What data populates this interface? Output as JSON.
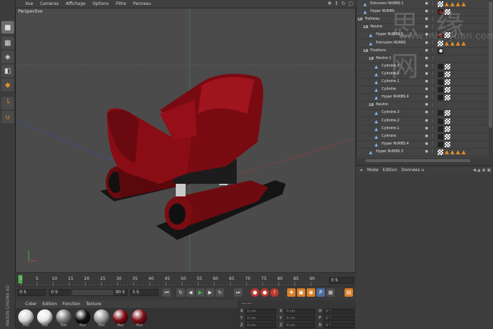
{
  "viewport_menu": [
    "Vue",
    "Caméras",
    "Affichage",
    "Options",
    "Filtre",
    "Panneau"
  ],
  "viewport_label": "Perspective",
  "timeline": {
    "ticks": [
      "0",
      "5",
      "10",
      "15",
      "20",
      "25",
      "30",
      "35",
      "40",
      "45",
      "50",
      "55",
      "60",
      "65",
      "70",
      "75",
      "80",
      "85",
      "90"
    ],
    "end_label": "0 S",
    "start_field": "0 S",
    "current_field": "0 S",
    "end_field": "90 S",
    "max_field": "3 S"
  },
  "material_menu": [
    "Créer",
    "Edition",
    "Fonction",
    "Texture"
  ],
  "materials": [
    {
      "label": "Mat",
      "color": "#d8d8d8"
    },
    {
      "label": "Mat",
      "color": "#e8e8e8"
    },
    {
      "label": "Mat",
      "color": "#7a7a7a"
    },
    {
      "label": "Mat",
      "color": "#111111"
    },
    {
      "label": "Mat",
      "color": "#9a9a9a"
    },
    {
      "label": "Mat",
      "color": "#7c0c12"
    },
    {
      "label": "Mat",
      "color": "#7e1016"
    }
  ],
  "coords": {
    "rows": [
      {
        "a": "X",
        "av": "0 cm",
        "b": "X",
        "bv": "0 cm",
        "c": "H",
        "cv": "0 °"
      },
      {
        "a": "Y",
        "av": "0 cm",
        "b": "Y",
        "bv": "0 cm",
        "c": "P",
        "cv": "0 °"
      },
      {
        "a": "Z",
        "av": "0 cm",
        "b": "Z",
        "bv": "0 cm",
        "c": "B",
        "cv": "0 °"
      }
    ]
  },
  "brand": "MAXON CINEMA 4D",
  "objects": [
    {
      "name": "Extrusion NURBS.1",
      "indent": 10,
      "icon": "nurbs",
      "tags": [
        "check",
        "tri",
        "tri",
        "tri",
        "tri"
      ]
    },
    {
      "name": "Hyper NURBS",
      "indent": 10,
      "icon": "nurbs",
      "tags": [
        "dot",
        "check"
      ]
    },
    {
      "name": "Traîneau",
      "indent": 2,
      "icon": "null",
      "tags": []
    },
    {
      "name": "Neutre",
      "indent": 10,
      "icon": "null",
      "tags": []
    },
    {
      "name": "Hyper NURBS.5",
      "indent": 18,
      "icon": "nurbs",
      "tags": [
        "dot",
        "check"
      ]
    },
    {
      "name": "Extrusion NURBS",
      "indent": 18,
      "icon": "nurbs",
      "tags": [
        "check",
        "tri",
        "tri",
        "tri",
        "tri"
      ]
    },
    {
      "name": "Fixations",
      "indent": 10,
      "icon": "null",
      "tags": [
        "dotw"
      ]
    },
    {
      "name": "Neutre.1",
      "indent": 18,
      "icon": "null",
      "tags": []
    },
    {
      "name": "Cylindre.3",
      "indent": 26,
      "icon": "nurbs",
      "tags": [
        "x",
        "check"
      ]
    },
    {
      "name": "Cylindre.2",
      "indent": 26,
      "icon": "nurbs",
      "tags": [
        "x",
        "check"
      ]
    },
    {
      "name": "Cylindre.1",
      "indent": 26,
      "icon": "nurbs",
      "tags": [
        "x",
        "check"
      ]
    },
    {
      "name": "Cylindre",
      "indent": 26,
      "icon": "nurbs",
      "tags": [
        "x",
        "check"
      ]
    },
    {
      "name": "Hyper NURBS.4",
      "indent": 26,
      "icon": "nurbs",
      "tags": [
        "x",
        "check"
      ]
    },
    {
      "name": "Neutre",
      "indent": 18,
      "icon": "null",
      "tags": []
    },
    {
      "name": "Cylindre.3",
      "indent": 26,
      "icon": "nurbs",
      "tags": [
        "x",
        "check"
      ]
    },
    {
      "name": "Cylindre.2",
      "indent": 26,
      "icon": "nurbs",
      "tags": [
        "x",
        "check"
      ]
    },
    {
      "name": "Cylindre.1",
      "indent": 26,
      "icon": "nurbs",
      "tags": [
        "x",
        "check"
      ]
    },
    {
      "name": "Cylindre",
      "indent": 26,
      "icon": "nurbs",
      "tags": [
        "x",
        "check"
      ]
    },
    {
      "name": "Hyper NURBS.4",
      "indent": 26,
      "icon": "nurbs",
      "tags": [
        "x",
        "check"
      ]
    },
    {
      "name": "Hyper NURBS.3",
      "indent": 18,
      "icon": "nurbs",
      "tags": [
        "check",
        "tri",
        "tri",
        "tri",
        "tri"
      ]
    }
  ],
  "attr_menu": [
    "Mode",
    "Edition",
    "Données u"
  ],
  "watermark": {
    "cjk": "思 缘 网",
    "url": "www.missyuan.com"
  }
}
